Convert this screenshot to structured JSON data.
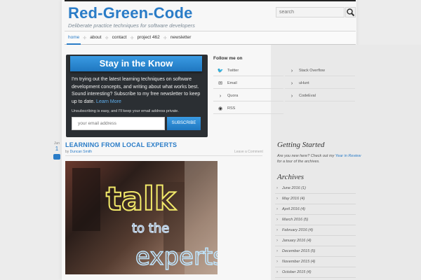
{
  "header": {
    "site_title": "Red-Green-Code",
    "tagline": "Deliberate practice techniques for software developers",
    "search_placeholder": "search"
  },
  "nav": {
    "items": [
      {
        "label": "home",
        "active": true
      },
      {
        "label": "about",
        "active": false
      },
      {
        "label": "contact",
        "active": false
      },
      {
        "label": "project 462",
        "active": false
      },
      {
        "label": "newsletter",
        "active": false
      }
    ]
  },
  "newsletter": {
    "banner": "Stay in the Know",
    "body": "I'm trying out the latest learning techniques on software development concepts, and writing about what works best. Sound interesting? Subscribe to my free newsletter to keep up to date.",
    "learn_more": "Learn More",
    "privacy": "Unsubscribing is easy, and I'll keep your email address private.",
    "email_placeholder": "your email address",
    "subscribe_label": "SUBSCRIBE"
  },
  "follow": {
    "title": "Follow me on",
    "items": [
      {
        "label": "Twitter",
        "icon": "twitter-icon"
      },
      {
        "label": "Stack Overflow",
        "icon": "chevron-right-icon"
      },
      {
        "label": "Email",
        "icon": "email-icon"
      },
      {
        "label": "uHunt",
        "icon": "chevron-right-icon"
      },
      {
        "label": "Quora",
        "icon": "chevron-right-icon"
      },
      {
        "label": "CodeEval",
        "icon": "chevron-right-icon"
      },
      {
        "label": "RSS",
        "icon": "rss-icon"
      }
    ]
  },
  "post": {
    "month": "Jun",
    "day": "1",
    "title": "LEARNING FROM LOCAL EXPERTS",
    "by": "by",
    "author": "Duncan Smith",
    "comment_link": "Leave a Comment",
    "image_text": [
      "talk",
      "to the",
      "experts"
    ]
  },
  "sidebar": {
    "getting_started_title": "Getting Started",
    "gs_text_before": "Are you new here? Check out my",
    "gs_link": "Year in Review",
    "gs_text_after": "for a tour of the archives.",
    "archives_title": "Archives",
    "archives": [
      "June 2016 (1)",
      "May 2016 (4)",
      "April 2016 (4)",
      "March 2016 (5)",
      "February 2016 (4)",
      "January 2016 (4)",
      "December 2015 (5)",
      "November 2015 (4)",
      "October 2015 (4)"
    ]
  },
  "colors": {
    "accent": "#2a7cc7",
    "newsletter_bg": "#2b2f33"
  }
}
